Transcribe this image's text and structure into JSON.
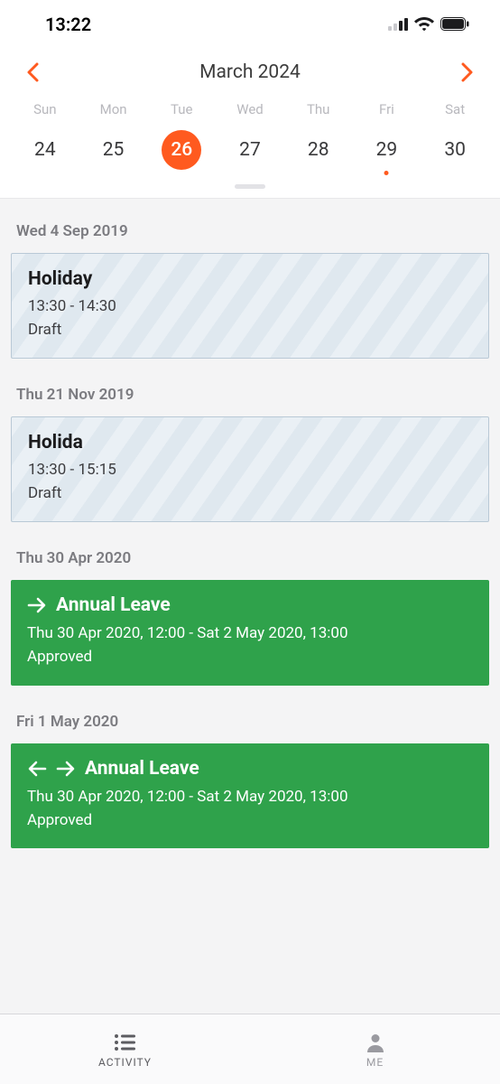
{
  "status": {
    "time": "13:22"
  },
  "calendar": {
    "title": "March 2024",
    "days": [
      "Sun",
      "Mon",
      "Tue",
      "Wed",
      "Thu",
      "Fri",
      "Sat"
    ],
    "dates": [
      {
        "n": "24",
        "selected": false,
        "dot": false
      },
      {
        "n": "25",
        "selected": false,
        "dot": false
      },
      {
        "n": "26",
        "selected": true,
        "dot": false
      },
      {
        "n": "27",
        "selected": false,
        "dot": false
      },
      {
        "n": "28",
        "selected": false,
        "dot": false
      },
      {
        "n": "29",
        "selected": false,
        "dot": true
      },
      {
        "n": "30",
        "selected": false,
        "dot": false
      }
    ]
  },
  "groups": [
    {
      "header": "Wed 4 Sep 2019",
      "card": {
        "style": "draft",
        "title": "Holiday",
        "time": "13:30 - 14:30",
        "status": "Draft",
        "arrows": 0
      }
    },
    {
      "header": "Thu 21 Nov 2019",
      "card": {
        "style": "draft",
        "title": "Holida",
        "time": "13:30 - 15:15",
        "status": "Draft",
        "arrows": 0
      }
    },
    {
      "header": "Thu 30 Apr 2020",
      "card": {
        "style": "approved",
        "title": "Annual Leave",
        "time": "Thu 30 Apr 2020, 12:00 - Sat 2 May 2020, 13:00",
        "status": "Approved",
        "arrows": 1
      }
    },
    {
      "header": "Fri 1 May 2020",
      "card": {
        "style": "approved",
        "title": "Annual Leave",
        "time": "Thu 30 Apr 2020, 12:00 - Sat 2 May 2020, 13:00",
        "status": "Approved",
        "arrows": 2
      }
    }
  ],
  "nav": {
    "activity": "ACTIVITY",
    "me": "ME"
  }
}
